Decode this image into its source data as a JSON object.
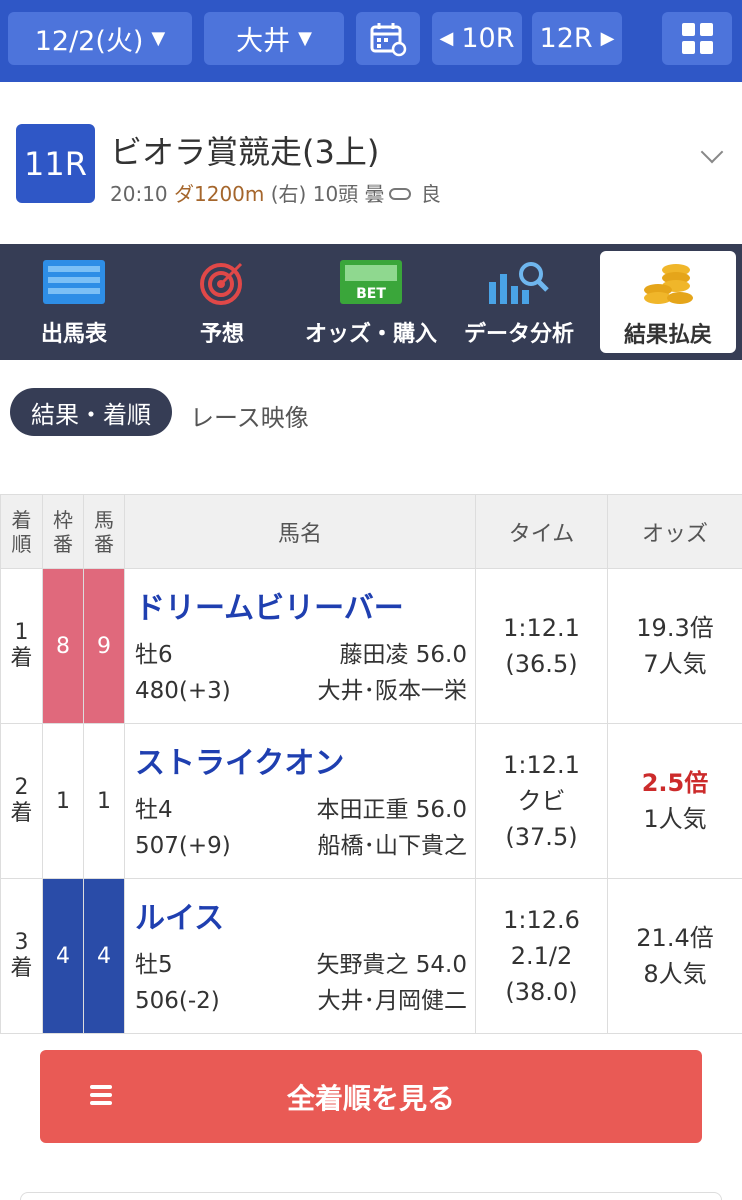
{
  "topbar": {
    "date": "12/2(火)",
    "venue": "大井",
    "prev_race": "10R",
    "next_race": "12R",
    "icons": [
      "calendar-icon",
      "grid-menu-icon"
    ]
  },
  "race": {
    "number": "11R",
    "name": "ビオラ賞競走(3上)",
    "time": "20:10",
    "course": "ダ1200m",
    "direction": "(右)",
    "runners": "10頭",
    "weather": "曇",
    "track": "良"
  },
  "nav": {
    "items": [
      {
        "label": "出馬表",
        "icon": "entries-list-icon"
      },
      {
        "label": "予想",
        "icon": "target-icon"
      },
      {
        "label": "オッズ・購入",
        "icon": "bet-icon"
      },
      {
        "label": "データ分析",
        "icon": "analysis-chart-icon"
      },
      {
        "label": "結果払戻",
        "icon": "coins-icon"
      }
    ],
    "active": "結果払戻"
  },
  "subtabs": {
    "active": "結果・着順",
    "other": "レース映像"
  },
  "table": {
    "headers": {
      "rank": "着順",
      "frame": "枠番",
      "horse_no": "馬番",
      "name": "馬名",
      "time": "タイム",
      "odds": "オッズ"
    },
    "rows": [
      {
        "rank_num": "1",
        "rank_suffix": "着",
        "frame": "8",
        "horse_no": "9",
        "frame_color": "#e0697c",
        "name": "ドリームビリーバー",
        "sex_age": "牡6",
        "jockey_weight": "藤田凌 56.0",
        "body_weight": "480(+3)",
        "trainer": "大井･阪本一栄",
        "time": "1:12.1",
        "margin": "",
        "last3f": "(36.5)",
        "odds": "19.3倍",
        "popularity": "7人気"
      },
      {
        "rank_num": "2",
        "rank_suffix": "着",
        "frame": "1",
        "horse_no": "1",
        "frame_color": "#ffffff",
        "name": "ストライクオン",
        "sex_age": "牡4",
        "jockey_weight": "本田正重 56.0",
        "body_weight": "507(+9)",
        "trainer": "船橋･山下貴之",
        "time": "1:12.1",
        "margin": "クビ",
        "last3f": "(37.5)",
        "odds": "2.5倍",
        "popularity": "1人気"
      },
      {
        "rank_num": "3",
        "rank_suffix": "着",
        "frame": "4",
        "horse_no": "4",
        "frame_color": "#2a4ca8",
        "name": "ルイス",
        "sex_age": "牡5",
        "jockey_weight": "矢野貴之 54.0",
        "body_weight": "506(-2)",
        "trainer": "大井･月岡健二",
        "time": "1:12.6",
        "margin": "2.1/2",
        "last3f": "(38.0)",
        "odds": "21.4倍",
        "popularity": "8人気"
      }
    ]
  },
  "all_results_button": "全着順を見る"
}
